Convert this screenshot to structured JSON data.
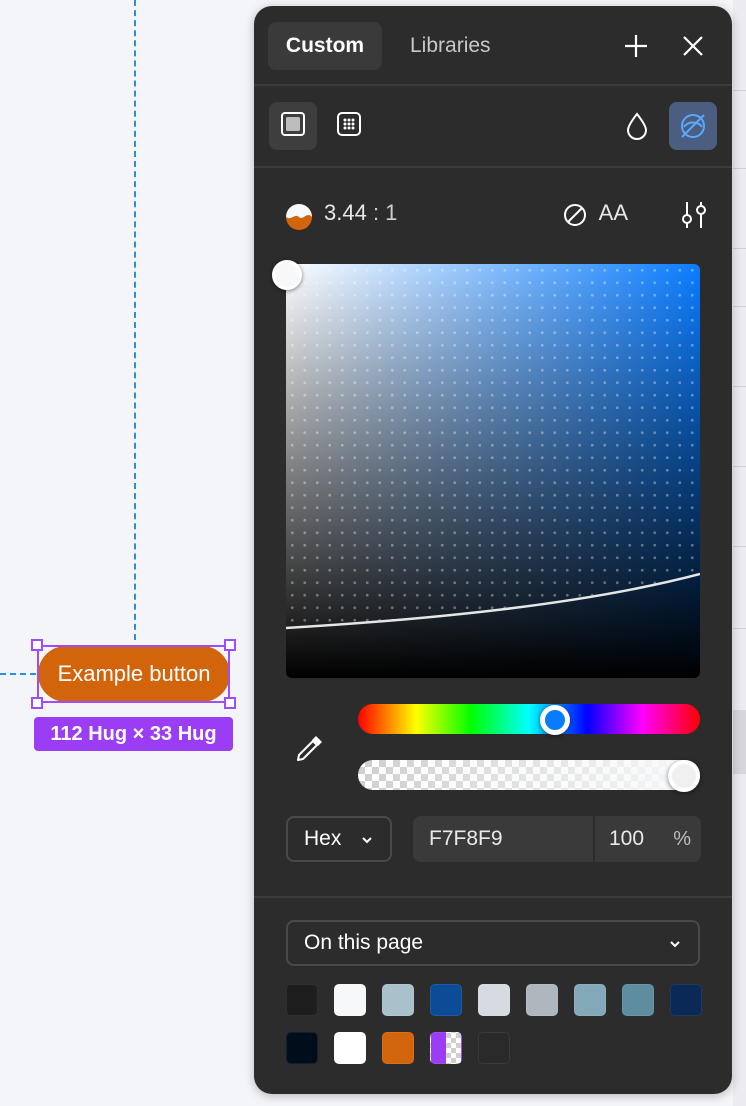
{
  "canvas": {
    "example_button_label": "Example button",
    "size_badge": "112 Hug × 33 Hug",
    "button_color": "#d2640c",
    "selection_color": "#9b3df5"
  },
  "picker": {
    "tabs": [
      {
        "label": "Custom",
        "active": true
      },
      {
        "label": "Libraries",
        "active": false
      }
    ],
    "header_icons": [
      "plus-icon",
      "close-icon"
    ],
    "paint_types": [
      "solid-fill-icon",
      "image-fill-icon"
    ],
    "toolbar_right_icons": [
      "drop-icon",
      "vision-simulation-icon"
    ],
    "contrast": {
      "ratio": "3.44",
      "separator": ": 1",
      "compliance": "AA",
      "compliance_icon": "fail-icon"
    },
    "current_color": {
      "format": "Hex",
      "hex": "F7F8F9",
      "opacity": "100",
      "opacity_unit": "%",
      "hue_color": "#0a7cff"
    },
    "library_select": "On this page",
    "swatches": [
      "#1e1e1e",
      "#f7f8f9",
      "#a9c1cb",
      "#0c4c96",
      "#d6dbe1",
      "#aeb6be",
      "#83a9b8",
      "#5e8da0",
      "#0a2a55",
      "#000e1c",
      "#ffffff",
      "#d2640c",
      "#9b3df5",
      "#2a2a2a"
    ]
  }
}
